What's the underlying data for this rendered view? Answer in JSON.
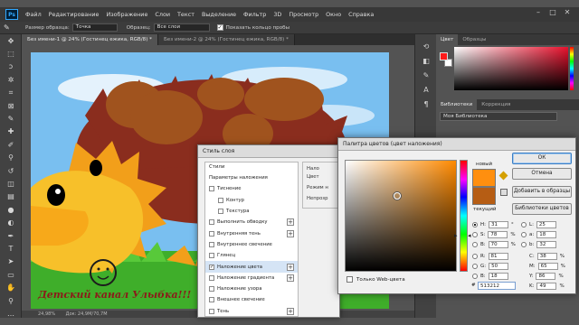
{
  "menubar": {
    "logo": "Ps",
    "items": [
      "Файл",
      "Редактирование",
      "Изображение",
      "Слои",
      "Текст",
      "Выделение",
      "Фильтр",
      "3D",
      "Просмотр",
      "Окно",
      "Справка"
    ],
    "minimize": "–",
    "restore": "□",
    "close": "✕"
  },
  "options": {
    "sample_size_label": "Размер образца:",
    "sample_size_value": "Точка",
    "sample_label": "Образец:",
    "sample_value": "Все слои",
    "show_ring_label": "Показать кольцо пробы",
    "show_ring_checked": "✓"
  },
  "doc_tabs": [
    "Без имени-1 @ 24% (Гостинец ежика, RGB/8) *",
    "Без имени-2 @ 24% (Гостинец ежика, RGB/8) *"
  ],
  "status": {
    "zoom": "24,98%",
    "doc": "Док: 24,9M/70,7M"
  },
  "canvas": {
    "watermark": "Детский канал Улыбка!!!"
  },
  "right": {
    "color_tabs": [
      "Цвет",
      "Образцы"
    ],
    "lib_tabs": [
      "Библиотеки",
      "Коррекция"
    ],
    "library_select": "Моя Библиотека",
    "colors": {
      "foreground": "#ff1a1a",
      "background": "#ffffff"
    }
  },
  "layer_style": {
    "title": "Стиль слоя",
    "header": "Стили",
    "rows": [
      {
        "label": "Параметры наложения",
        "checkbox": false,
        "plus": false,
        "checked": ""
      },
      {
        "label": "Тиснение",
        "checkbox": true,
        "plus": false,
        "checked": ""
      },
      {
        "label": "Контур",
        "checkbox": true,
        "plus": false,
        "checked": "",
        "indent": true
      },
      {
        "label": "Текстура",
        "checkbox": true,
        "plus": false,
        "checked": "",
        "indent": true
      },
      {
        "label": "Выполнить обводку",
        "checkbox": true,
        "plus": true,
        "checked": ""
      },
      {
        "label": "Внутренняя тень",
        "checkbox": true,
        "plus": true,
        "checked": ""
      },
      {
        "label": "Внутреннее свечение",
        "checkbox": true,
        "plus": false,
        "checked": ""
      },
      {
        "label": "Глянец",
        "checkbox": true,
        "plus": false,
        "checked": ""
      },
      {
        "label": "Наложение цвета",
        "checkbox": true,
        "plus": true,
        "checked": "✓",
        "selected": true
      },
      {
        "label": "Наложение градиента",
        "checkbox": true,
        "plus": true,
        "checked": ""
      },
      {
        "label": "Наложение узора",
        "checkbox": true,
        "plus": false,
        "checked": ""
      },
      {
        "label": "Внешнее свечение",
        "checkbox": true,
        "plus": false,
        "checked": ""
      },
      {
        "label": "Тень",
        "checkbox": true,
        "plus": true,
        "checked": ""
      }
    ],
    "right_title": "Нало",
    "right_lines": [
      "Цвет",
      "Режим н",
      "Непрозр"
    ]
  },
  "color_picker": {
    "title": "Палитра цветов (цвет наложения)",
    "new_label": "новый",
    "current_label": "текущий",
    "new_color": "#ff8f0f",
    "current_color": "#b65d14",
    "buttons": {
      "ok": "ОК",
      "cancel": "Отмена",
      "add_swatch": "Добавить в образцы",
      "libraries": "Библиотеки цветов"
    },
    "web_only_label": "Только Web-цвета",
    "fields": {
      "H": "31",
      "S": "78",
      "B": "70",
      "R": "81",
      "G": "50",
      "Bv": "18",
      "L": "25",
      "a": "18",
      "b": "32",
      "C": "38",
      "M": "65",
      "Y": "86",
      "K": "49"
    },
    "units": {
      "deg": "°",
      "pct": "%"
    },
    "hex_label": "#",
    "hex": "513212"
  }
}
